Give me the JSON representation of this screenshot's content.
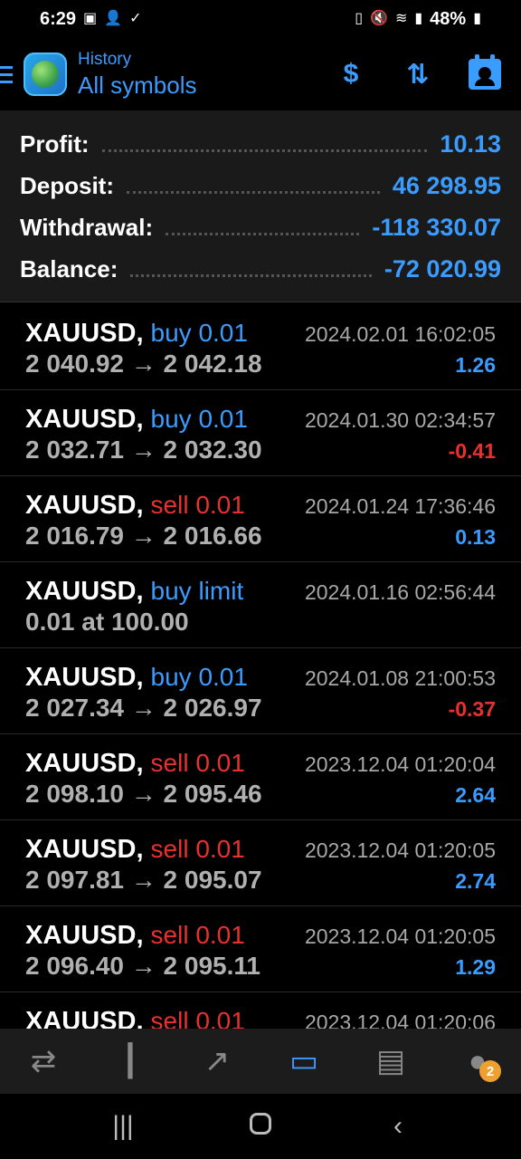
{
  "statusbar": {
    "time": "6:29",
    "battery": "48%"
  },
  "header": {
    "subtitle": "History",
    "title": "All symbols"
  },
  "summary": [
    {
      "label": "Profit:",
      "value": "10.13"
    },
    {
      "label": "Deposit:",
      "value": "46 298.95"
    },
    {
      "label": "Withdrawal:",
      "value": "-118 330.07"
    },
    {
      "label": "Balance:",
      "value": "-72 020.99"
    }
  ],
  "trades": [
    {
      "symbol": "XAUUSD",
      "side": "buy 0.01",
      "side_type": "buy",
      "time": "2024.02.01 16:02:05",
      "prices": "2 040.92 → 2 042.18",
      "profit": "1.26",
      "profit_sign": "pos"
    },
    {
      "symbol": "XAUUSD",
      "side": "buy 0.01",
      "side_type": "buy",
      "time": "2024.01.30 02:34:57",
      "prices": "2 032.71 → 2 032.30",
      "profit": "-0.41",
      "profit_sign": "neg"
    },
    {
      "symbol": "XAUUSD",
      "side": "sell 0.01",
      "side_type": "sell",
      "time": "2024.01.24 17:36:46",
      "prices": "2 016.79 → 2 016.66",
      "profit": "0.13",
      "profit_sign": "pos"
    },
    {
      "symbol": "XAUUSD",
      "side": "buy limit",
      "side_type": "buy",
      "time": "2024.01.16 02:56:44",
      "prices": "0.01 at 100.00",
      "profit": "",
      "profit_sign": "pos"
    },
    {
      "symbol": "XAUUSD",
      "side": "buy 0.01",
      "side_type": "buy",
      "time": "2024.01.08 21:00:53",
      "prices": "2 027.34 → 2 026.97",
      "profit": "-0.37",
      "profit_sign": "neg"
    },
    {
      "symbol": "XAUUSD",
      "side": "sell 0.01",
      "side_type": "sell",
      "time": "2023.12.04 01:20:04",
      "prices": "2 098.10 → 2 095.46",
      "profit": "2.64",
      "profit_sign": "pos"
    },
    {
      "symbol": "XAUUSD",
      "side": "sell 0.01",
      "side_type": "sell",
      "time": "2023.12.04 01:20:05",
      "prices": "2 097.81 → 2 095.07",
      "profit": "2.74",
      "profit_sign": "pos"
    },
    {
      "symbol": "XAUUSD",
      "side": "sell 0.01",
      "side_type": "sell",
      "time": "2023.12.04 01:20:05",
      "prices": "2 096.40 → 2 095.11",
      "profit": "1.29",
      "profit_sign": "pos"
    },
    {
      "symbol": "XAUUSD",
      "side": "sell 0.01",
      "side_type": "sell",
      "time": "2023.12.04 01:20:06",
      "prices": "",
      "profit": "",
      "profit_sign": "pos"
    }
  ],
  "bottomnav": {
    "items": [
      {
        "icon": "quotes-icon"
      },
      {
        "icon": "chart-icon"
      },
      {
        "icon": "trade-icon"
      },
      {
        "icon": "history-icon"
      },
      {
        "icon": "news-icon"
      },
      {
        "icon": "messages-icon",
        "badge": "2"
      }
    ]
  },
  "colors": {
    "accent": "#3b9cff",
    "negative": "#e8312f",
    "badge": "#f0a030"
  }
}
